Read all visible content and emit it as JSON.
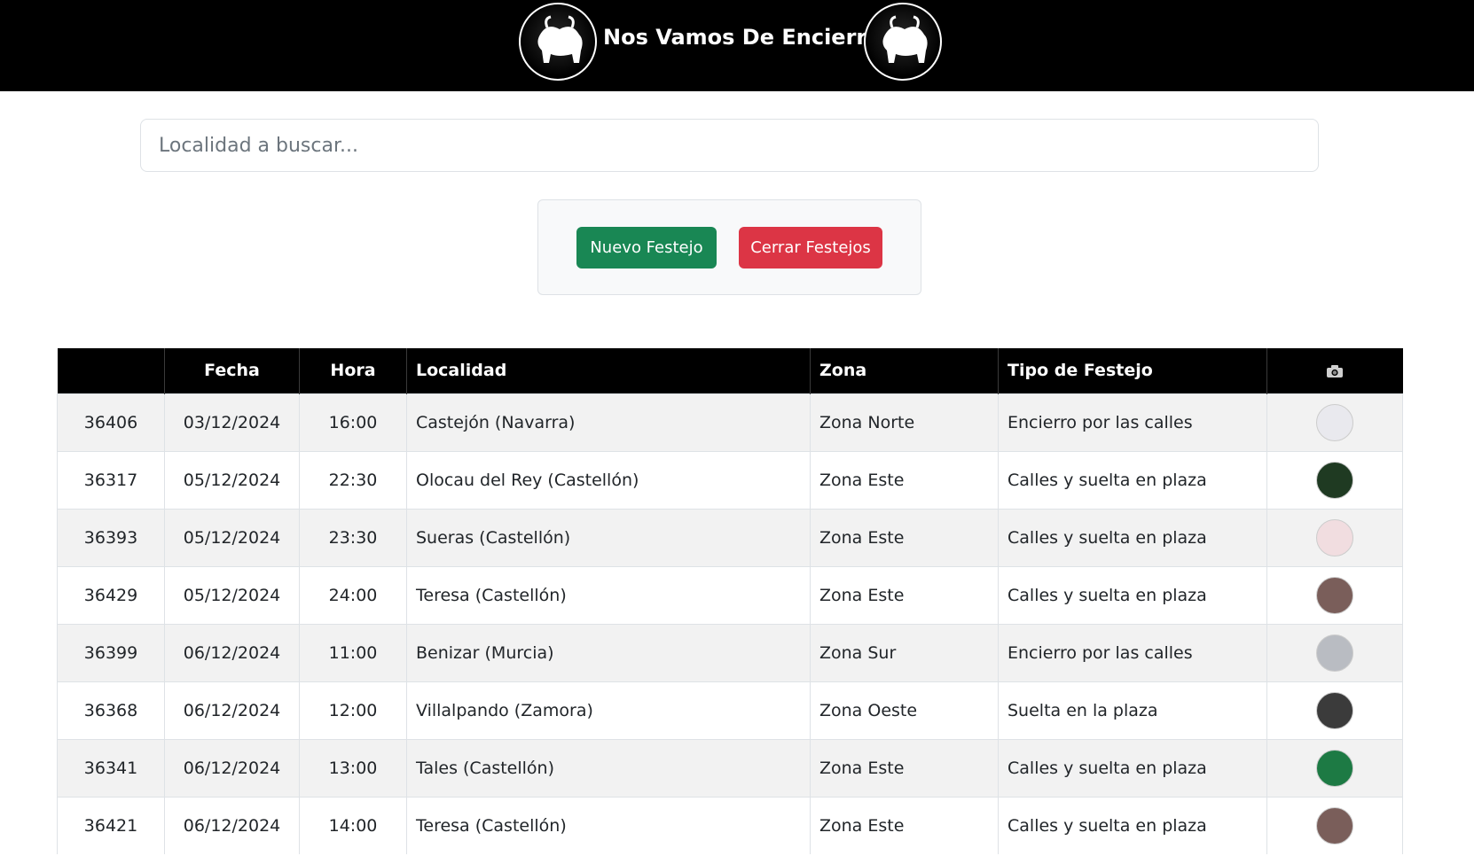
{
  "header": {
    "title": "Nos Vamos De Encierro",
    "logo_icon": "bull-icon"
  },
  "search": {
    "placeholder": "Localidad a buscar...",
    "value": ""
  },
  "actions": {
    "new_label": "Nuevo Festejo",
    "close_label": "Cerrar Festejos",
    "new_color": "#198754",
    "close_color": "#dc3545"
  },
  "table": {
    "headers": {
      "id": "",
      "fecha": "Fecha",
      "hora": "Hora",
      "localidad": "Localidad",
      "zona": "Zona",
      "tipo": "Tipo de Festejo",
      "photo_icon": "camera-icon"
    },
    "rows": [
      {
        "id": "36406",
        "fecha": "03/12/2024",
        "hora": "16:00",
        "localidad": "Castejón (Navarra)",
        "zona": "Zona Norte",
        "tipo": "Encierro por las calles",
        "thumb_color": "#e9e9ee"
      },
      {
        "id": "36317",
        "fecha": "05/12/2024",
        "hora": "22:30",
        "localidad": "Olocau del Rey (Castellón)",
        "zona": "Zona Este",
        "tipo": "Calles y suelta en plaza",
        "thumb_color": "#1f3a22"
      },
      {
        "id": "36393",
        "fecha": "05/12/2024",
        "hora": "23:30",
        "localidad": "Sueras (Castellón)",
        "zona": "Zona Este",
        "tipo": "Calles y suelta en plaza",
        "thumb_color": "#f1dde0"
      },
      {
        "id": "36429",
        "fecha": "05/12/2024",
        "hora": "24:00",
        "localidad": "Teresa (Castellón)",
        "zona": "Zona Este",
        "tipo": "Calles y suelta en plaza",
        "thumb_color": "#7a5e5a"
      },
      {
        "id": "36399",
        "fecha": "06/12/2024",
        "hora": "11:00",
        "localidad": "Benizar (Murcia)",
        "zona": "Zona Sur",
        "tipo": "Encierro por las calles",
        "thumb_color": "#b9bcc2"
      },
      {
        "id": "36368",
        "fecha": "06/12/2024",
        "hora": "12:00",
        "localidad": "Villalpando (Zamora)",
        "zona": "Zona Oeste",
        "tipo": "Suelta en la plaza",
        "thumb_color": "#3b3b3b"
      },
      {
        "id": "36341",
        "fecha": "06/12/2024",
        "hora": "13:00",
        "localidad": "Tales (Castellón)",
        "zona": "Zona Este",
        "tipo": "Calles y suelta en plaza",
        "thumb_color": "#1d7a44"
      },
      {
        "id": "36421",
        "fecha": "06/12/2024",
        "hora": "14:00",
        "localidad": "Teresa (Castellón)",
        "zona": "Zona Este",
        "tipo": "Calles y suelta en plaza",
        "thumb_color": "#7a5e5a"
      }
    ]
  }
}
